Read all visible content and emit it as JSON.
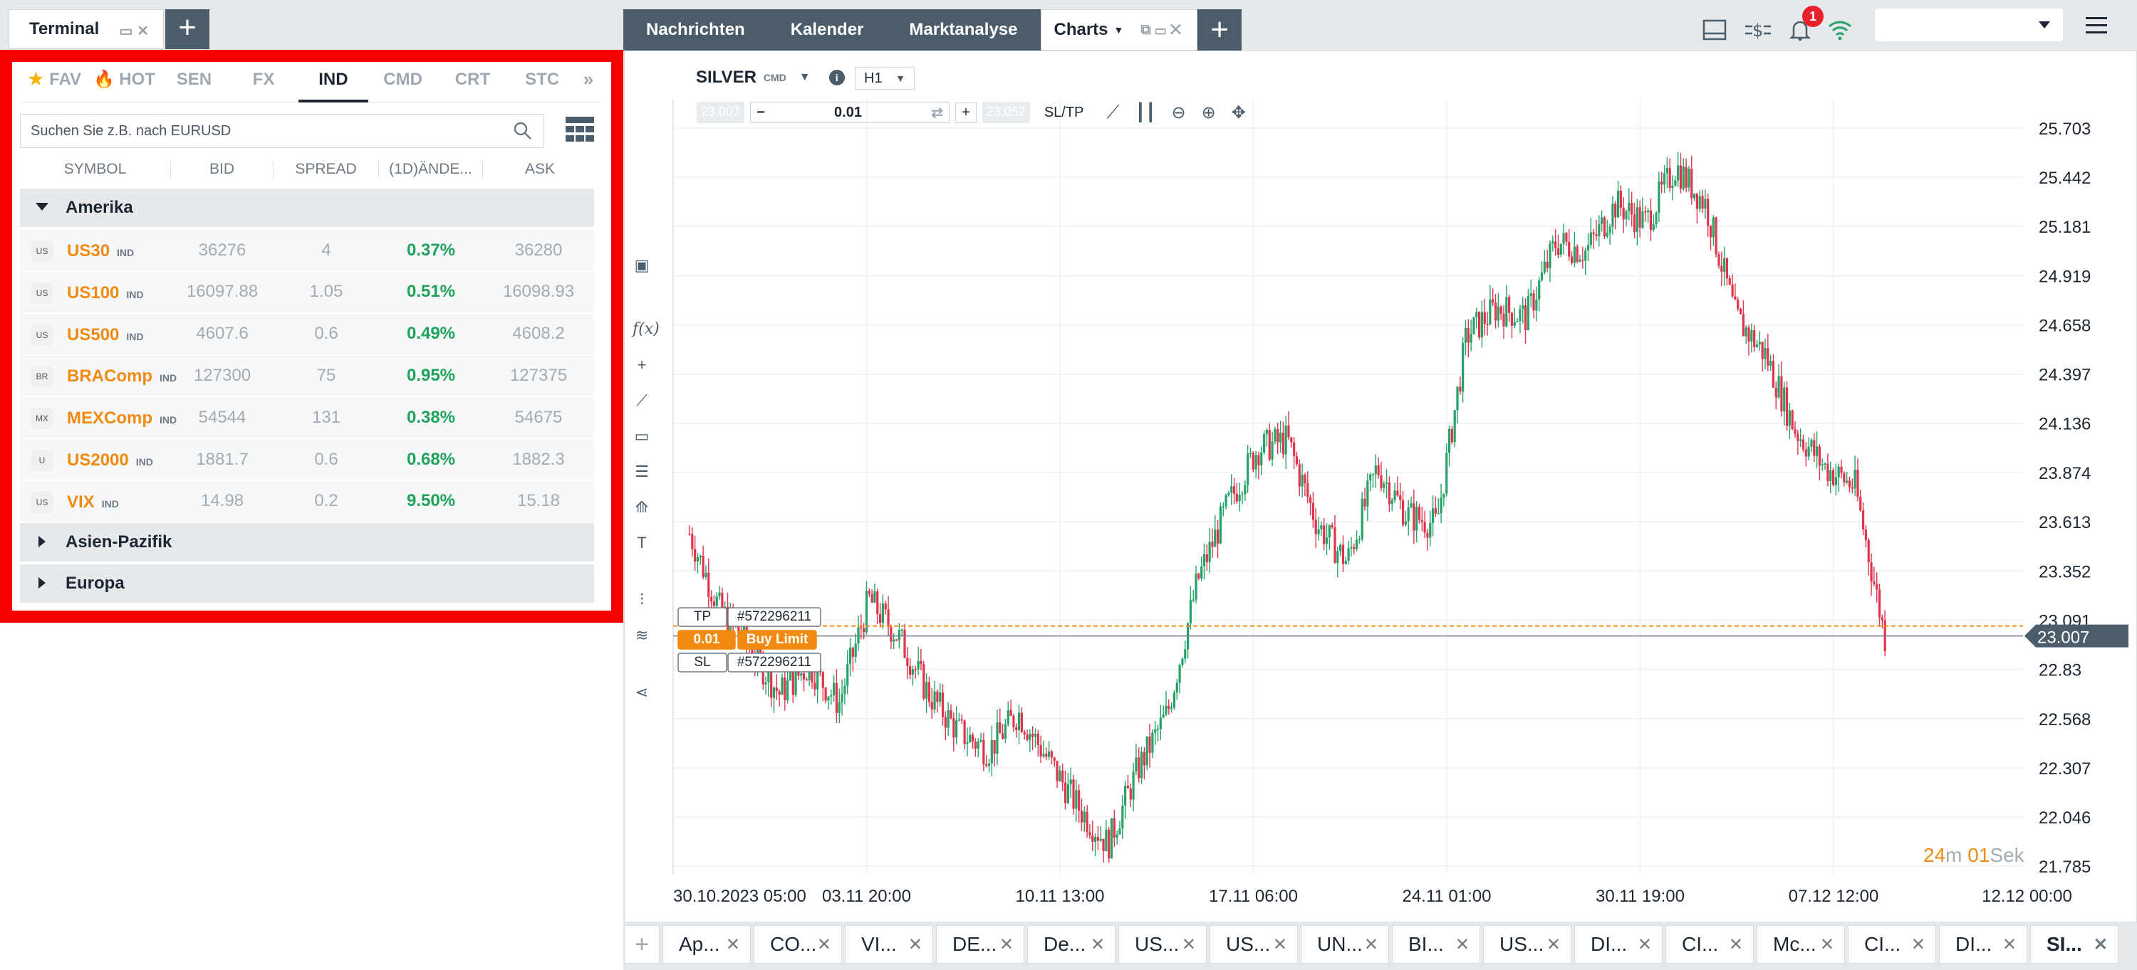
{
  "terminal_tab": {
    "label": "Terminal"
  },
  "watchlist": {
    "tabs": [
      "FAV",
      "HOT",
      "SEN",
      "FX",
      "IND",
      "CMD",
      "CRT",
      "STC"
    ],
    "active_tab": "IND",
    "search_placeholder": "Suchen Sie z.B. nach EURUSD",
    "columns": [
      "SYMBOL",
      "BID",
      "SPREAD",
      "(1D)ÄNDE...",
      "ASK"
    ],
    "groups": [
      {
        "name": "Amerika",
        "expanded": true
      },
      {
        "name": "Asien-Pazifik",
        "expanded": false
      },
      {
        "name": "Europa",
        "expanded": false
      }
    ],
    "rows": [
      {
        "symbol": "US30",
        "tag": "IND",
        "flag": "US",
        "bid": "36276",
        "spread": "4",
        "change": "0.37%",
        "ask": "36280"
      },
      {
        "symbol": "US100",
        "tag": "IND",
        "flag": "US",
        "bid": "16097.88",
        "spread": "1.05",
        "change": "0.51%",
        "ask": "16098.93"
      },
      {
        "symbol": "US500",
        "tag": "IND",
        "flag": "US",
        "bid": "4607.6",
        "spread": "0.6",
        "change": "0.49%",
        "ask": "4608.2"
      },
      {
        "symbol": "BRAComp",
        "tag": "IND",
        "flag": "BR",
        "bid": "127300",
        "spread": "75",
        "change": "0.95%",
        "ask": "127375"
      },
      {
        "symbol": "MEXComp",
        "tag": "IND",
        "flag": "MX",
        "bid": "54544",
        "spread": "131",
        "change": "0.38%",
        "ask": "54675"
      },
      {
        "symbol": "US2000",
        "tag": "IND",
        "flag": "U",
        "bid": "1881.7",
        "spread": "0.6",
        "change": "0.68%",
        "ask": "1882.3"
      },
      {
        "symbol": "VIX",
        "tag": "IND",
        "flag": "US",
        "bid": "14.98",
        "spread": "0.2",
        "change": "9.50%",
        "ask": "15.18"
      }
    ]
  },
  "topnav": {
    "items": [
      "Nachrichten",
      "Kalender",
      "Marktanalyse"
    ],
    "active": "Charts"
  },
  "notifications": {
    "count": "1"
  },
  "chart": {
    "symbol": "SILVER",
    "symbol_tag": "CMD",
    "timeframe": "H1",
    "sell_price": "23.007",
    "buy_price": "23.052",
    "volume": "0.01",
    "sl_tp_label": "SL/TP",
    "order": {
      "tp_label": "TP",
      "sl_label": "SL",
      "id": "#572296211",
      "volume": "0.01",
      "type": "Buy Limit"
    },
    "current_price": "23.007",
    "timer_min": "24",
    "timer_min_unit": "m",
    "timer_sec": "01",
    "timer_sec_unit": "Sek",
    "colors": {
      "up": "#26a269",
      "down": "#e0344b",
      "order": "#f08a11"
    }
  },
  "chart_data": {
    "type": "candlestick",
    "y_ticks": [
      25.703,
      25.442,
      25.181,
      24.919,
      24.658,
      24.397,
      24.136,
      23.874,
      23.613,
      23.352,
      23.091,
      22.83,
      22.568,
      22.307,
      22.046,
      21.785
    ],
    "x_ticks": [
      "30.10.2023 05:00",
      "03.11 20:00",
      "10.11 13:00",
      "17.11 06:00",
      "24.11 01:00",
      "30.11 19:00",
      "07.12 12:00",
      "12.12 00:00"
    ],
    "ylim": [
      21.785,
      25.703
    ],
    "path_keypoints": [
      23.55,
      23.15,
      22.95,
      22.7,
      22.85,
      22.65,
      23.2,
      23.0,
      22.7,
      22.5,
      22.4,
      22.6,
      22.35,
      22.1,
      21.9,
      22.3,
      22.6,
      23.3,
      23.7,
      24.0,
      24.05,
      23.6,
      23.4,
      23.9,
      23.65,
      23.6,
      24.6,
      24.75,
      24.7,
      25.1,
      25.05,
      25.3,
      25.2,
      25.5,
      25.3,
      24.7,
      24.5,
      24.1,
      23.9,
      23.8,
      23.0
    ],
    "grid": true
  },
  "bottom_tabs": [
    "Ap...",
    "CO...",
    "VI...",
    "DE...",
    "De...",
    "US...",
    "US...",
    "UN...",
    "BI...",
    "US...",
    "DI...",
    "CI...",
    "Mc...",
    "CI...",
    "DI...",
    "SI..."
  ]
}
